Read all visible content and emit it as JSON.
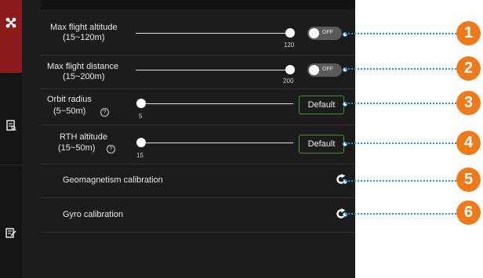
{
  "sidebar": {
    "items": [
      {
        "icon": "drone-icon",
        "active": true
      },
      {
        "icon": "document-icon",
        "active": false
      },
      {
        "icon": "edit-document-icon",
        "active": false
      }
    ]
  },
  "settings": {
    "max_altitude": {
      "label_line1": "Max flight altitude",
      "label_line2": "(15~120m)",
      "value": "120",
      "toggle_label": "OFF"
    },
    "max_distance": {
      "label_line1": "Max flight distance",
      "label_line2": "(15~200m)",
      "value": "200",
      "toggle_label": "OFF"
    },
    "orbit_radius": {
      "label_line1": "Orbit radius",
      "label_line2": "(5~50m)",
      "value": "5",
      "button": "Default"
    },
    "rth_altitude": {
      "label_line1": "RTH altitude",
      "label_line2": "(15~50m)",
      "value": "15",
      "button": "Default"
    },
    "geomagnetism": {
      "label": "Geomagnetism calibration"
    },
    "gyro": {
      "label": "Gyro calibration"
    }
  },
  "callouts": [
    "1",
    "2",
    "3",
    "4",
    "5",
    "6"
  ],
  "colors": {
    "callout": "#ef7a1a",
    "leader": "#2a93d5",
    "active_tab": "#8e1b1b",
    "default_border": "#4d8d3c"
  }
}
